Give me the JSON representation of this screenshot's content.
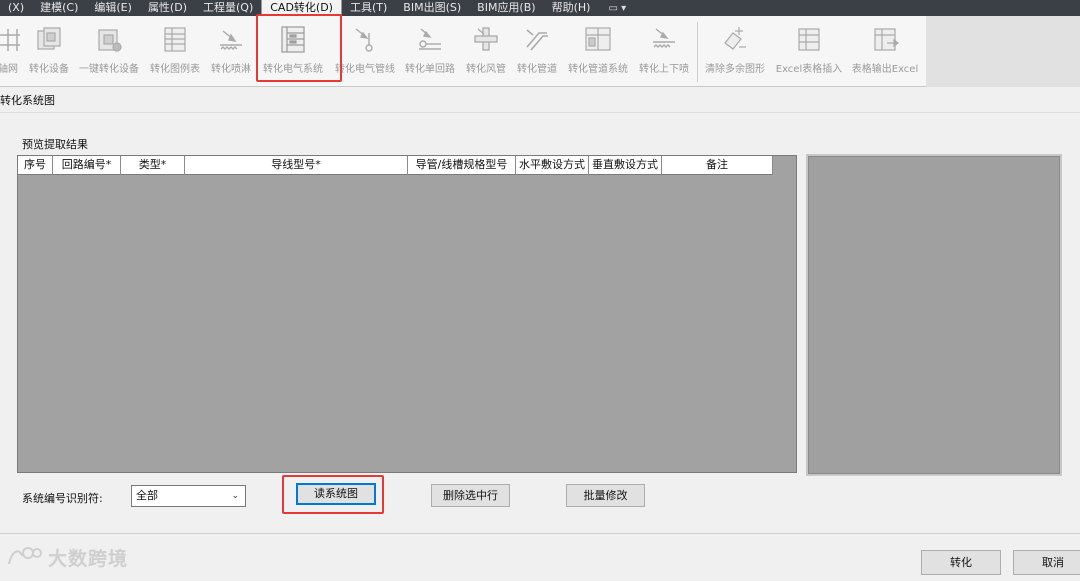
{
  "menu": {
    "items": [
      "(X)",
      "建模(C)",
      "编辑(E)",
      "属性(D)",
      "工程量(Q)",
      "CAD转化(D)",
      "工具(T)",
      "BIM出图(S)",
      "BIM应用(B)",
      "帮助(H)"
    ],
    "extra": "▭ ▾"
  },
  "ribbon": {
    "tools": [
      {
        "label": "轴网",
        "icon": "grid-icon"
      },
      {
        "label": "转化设备",
        "icon": "equipment-icon"
      },
      {
        "label": "一键转化设备",
        "icon": "one-click-equipment-icon"
      },
      {
        "label": "转化图例表",
        "icon": "legend-table-icon"
      },
      {
        "label": "转化喷淋",
        "icon": "sprinkler-icon"
      },
      {
        "label": "转化电气系统",
        "icon": "electrical-system-icon"
      },
      {
        "label": "转化电气管线",
        "icon": "electrical-pipeline-icon"
      },
      {
        "label": "转化单回路",
        "icon": "single-circuit-icon"
      },
      {
        "label": "转化风管",
        "icon": "air-duct-icon"
      },
      {
        "label": "转化管道",
        "icon": "pipe-icon"
      },
      {
        "label": "转化管道系统",
        "icon": "pipe-system-icon"
      },
      {
        "label": "转化上下喷",
        "icon": "up-down-spray-icon"
      },
      {
        "label": "清除多余图形",
        "icon": "clear-graphics-icon"
      },
      {
        "label": "Excel表格插入",
        "icon": "excel-insert-icon"
      },
      {
        "label": "表格输出Excel",
        "icon": "excel-export-icon"
      }
    ]
  },
  "dialog": {
    "title": "转化系统图",
    "section_label": "预览提取结果",
    "columns": [
      "序号",
      "回路编号*",
      "类型*",
      "导线型号*",
      "导管/线槽规格型号",
      "水平敷设方式",
      "垂直敷设方式",
      "备注"
    ],
    "id_label": "系统编号识别符:",
    "id_select_value": "全部",
    "read_button": "读系统图",
    "delete_button": "删除选中行",
    "batch_button": "批量修改",
    "convert_button": "转化",
    "cancel_button": "取消"
  },
  "watermark": {
    "text": "大数跨境"
  },
  "colors": {
    "highlight": "#e53935",
    "menubar": "#3b3f46",
    "table_bg": "#a2a2a2"
  }
}
